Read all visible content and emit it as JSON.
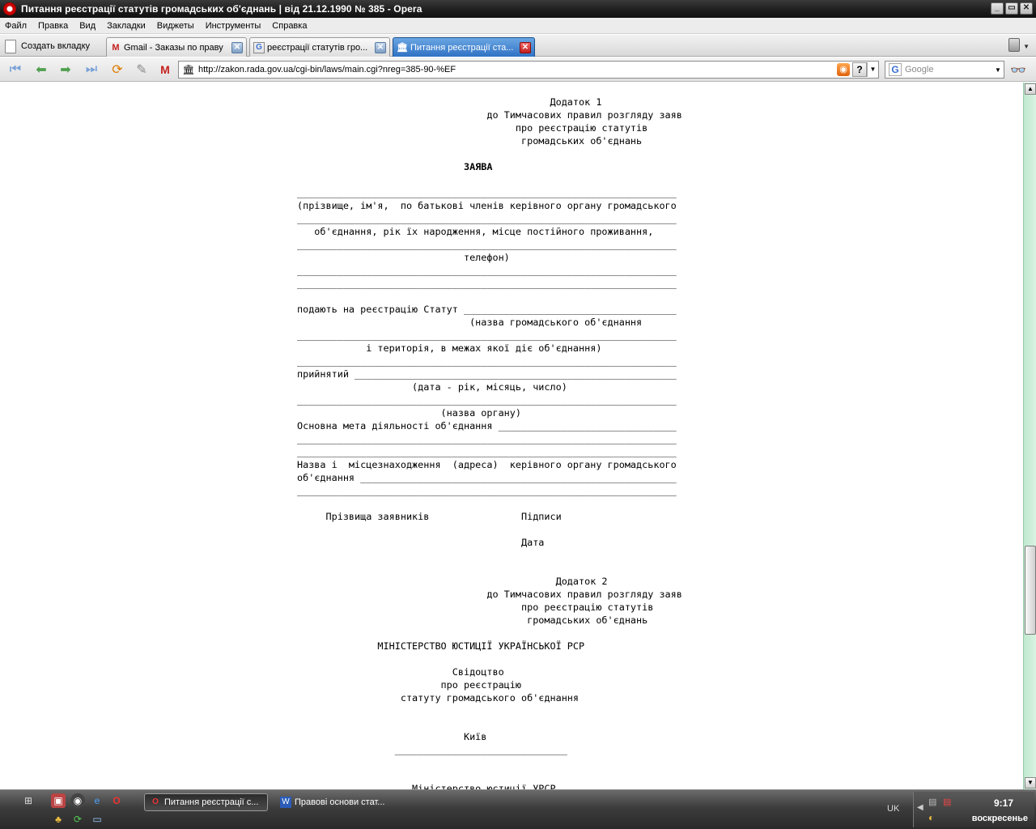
{
  "window": {
    "title": "Питання реєстрації статутів громадських об'єднань | від 21.12.1990 № 385 - Opera",
    "controls": [
      "_",
      "▭",
      "✕"
    ]
  },
  "menu": [
    "Файл",
    "Правка",
    "Вид",
    "Закладки",
    "Виджеты",
    "Инструменты",
    "Справка"
  ],
  "tabs": {
    "new_tab_label": "Создать вкладку",
    "items": [
      {
        "label": "Gmail - Заказы по праву",
        "icon": "gmail-icon",
        "active": false
      },
      {
        "label": "реєстрації статутів гро...",
        "icon": "google-icon",
        "active": false
      },
      {
        "label": "Питання реєстрації ста...",
        "icon": "rada-icon",
        "active": true
      }
    ]
  },
  "toolbar": {
    "url": "http://zakon.rada.gov.ua/cgi-bin/laws/main.cgi?nreg=385-90-%EF",
    "search_placeholder": "Google",
    "help_label": "?"
  },
  "document": {
    "appendix1": [
      "                                            Додаток 1",
      "                                 до Тимчасових правил розгляду заяв",
      "                                      про реєстрацію статутів",
      "                                       громадських об'єднань",
      "",
      "                             ЗАЯВА",
      "",
      "__________________________________________________________________",
      "(прізвище, ім'я,  по батькові членів керівного органу громадського",
      "__________________________________________________________________",
      "   об'єднання, рік їх народження, місце постійного проживання,",
      "__________________________________________________________________",
      "                             телефон)",
      "__________________________________________________________________",
      "__________________________________________________________________",
      "",
      "подають на реєстрацію Статут _____________________________________",
      "                              (назва громадського об'єднання",
      "__________________________________________________________________",
      "            і територія, в межах якої діє об'єднання)",
      "__________________________________________________________________",
      "прийнятий ________________________________________________________",
      "                    (дата - рік, місяць, число)",
      "__________________________________________________________________",
      "                         (назва органу)",
      "Основна мета діяльності об'єднання _______________________________",
      "__________________________________________________________________",
      "__________________________________________________________________",
      "Назва і  місцезнаходження  (адреса)  керівного органу громадського",
      "об'єднання _______________________________________________________",
      "__________________________________________________________________",
      "",
      "     Прізвища заявників                Підписи",
      "",
      "                                       Дата",
      "",
      "",
      "                                             Додаток 2",
      "                                 до Тимчасових правил розгляду заяв",
      "                                       про реєстрацію статутів",
      "                                        громадських об'єднань",
      "",
      "              МІНІСТЕРСТВО ЮСТИЦІЇ УКРАЇНСЬКОЇ РСР",
      "",
      "                           Свідоцтво",
      "                         про реєстрацію",
      "                  статуту громадського об'єднання",
      "",
      "",
      "                             Київ",
      "                 ______________________________",
      "",
      "",
      "                    Міністерство юстиції УРСР"
    ]
  },
  "taskbar": {
    "tasks": [
      {
        "label": "Питання реєстрації с...",
        "active": true,
        "icon": "opera-icon"
      },
      {
        "label": "Правові основи стат...",
        "active": false,
        "icon": "word-icon"
      }
    ],
    "language": "UK",
    "time": "9:17",
    "day": "воскресенье"
  }
}
